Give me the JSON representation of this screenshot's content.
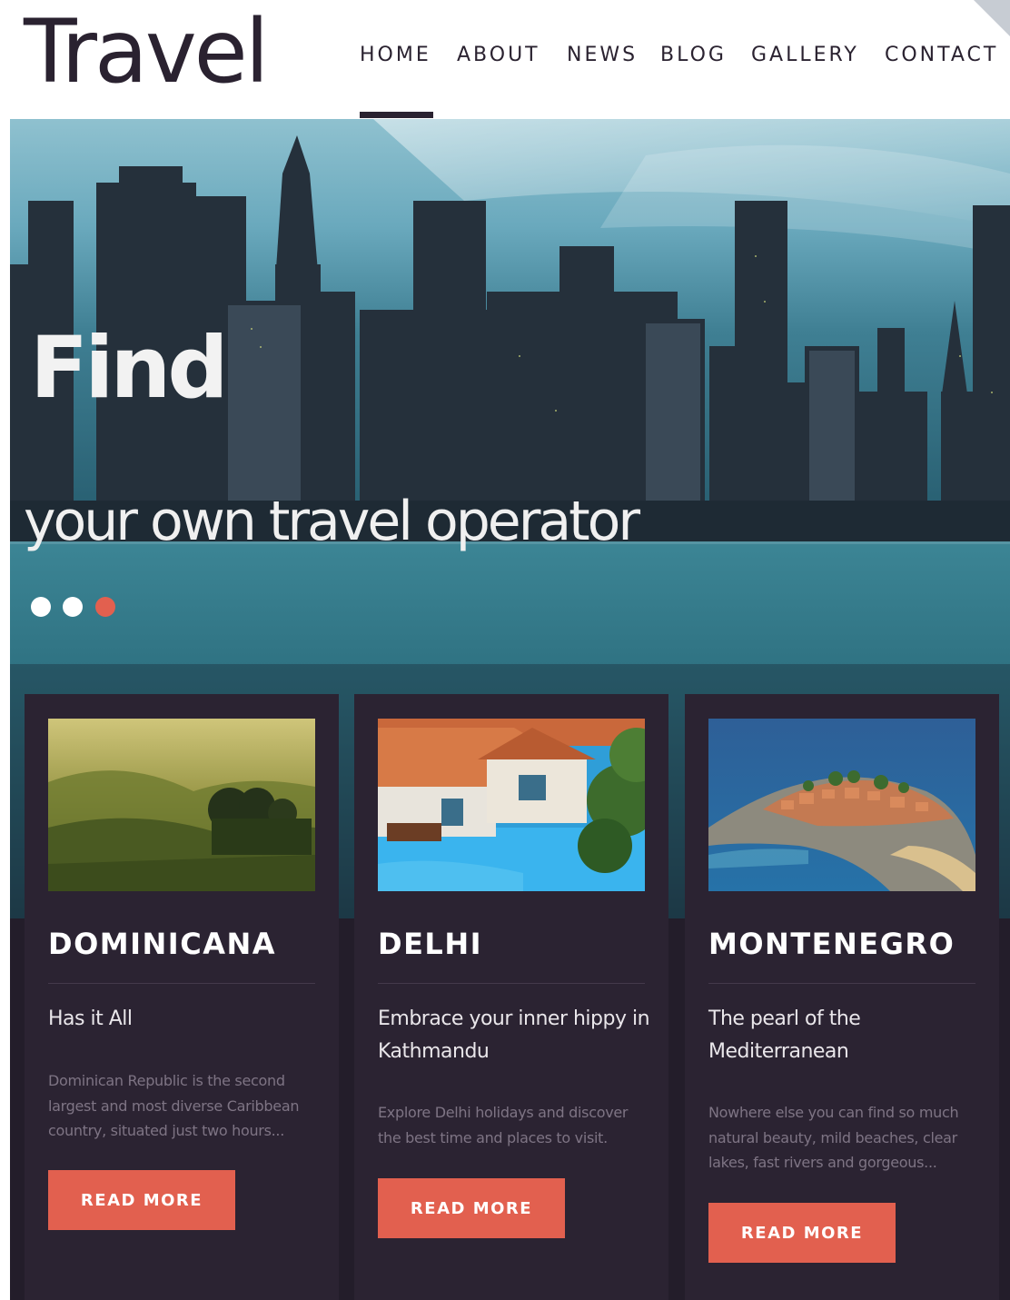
{
  "header": {
    "logo": "Travel",
    "nav": [
      "HOME",
      "ABOUT",
      "NEWS",
      "BLOG",
      "GALLERY",
      "CONTACT"
    ],
    "active_nav": "HOME"
  },
  "hero": {
    "title": "Find",
    "subtitle": "your own travel operator",
    "slides_count": 3,
    "active_slide": 3
  },
  "cards": [
    {
      "title": "DOMINICANA",
      "subtitle": "Has it All",
      "text": "Dominican Republic is the second largest and most diverse Caribbean country, situated just two hours...",
      "button": "READ MORE"
    },
    {
      "title": "DELHI",
      "subtitle": "Embrace your inner hippy in Kathmandu",
      "text": "Explore Delhi holidays and discover the best time and places to visit.",
      "button": "READ MORE"
    },
    {
      "title": "MONTENEGRO",
      "subtitle": "The pearl of the Mediterranean",
      "text": "Nowhere else you can find so much natural beauty, mild beaches, clear lakes, fast rivers and gorgeous...",
      "button": "READ MORE"
    }
  ],
  "colors": {
    "accent": "#e2604f",
    "dark": "#2a2230",
    "card_bg": "#2b2332"
  }
}
